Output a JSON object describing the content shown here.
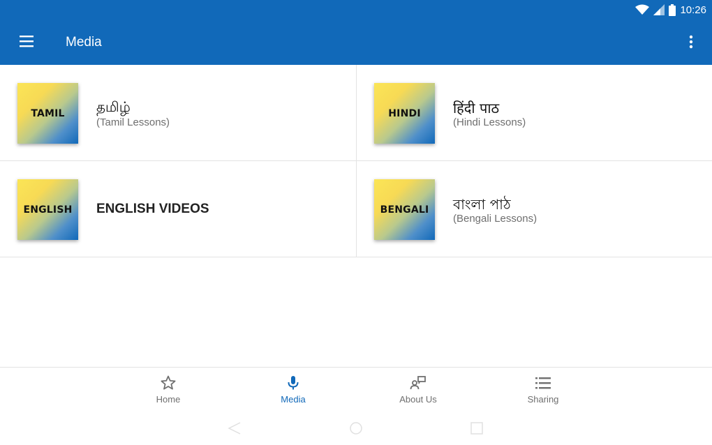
{
  "status_bar": {
    "time": "10:26"
  },
  "app_bar": {
    "title": "Media",
    "menu_icon": "hamburger-menu-icon",
    "overflow_icon": "more-vert-icon"
  },
  "media_items": [
    {
      "thumb_label": "TAMIL",
      "title": "தமிழ்",
      "subtitle": "(Tamil Lessons)"
    },
    {
      "thumb_label": "HINDI",
      "title": "हिंदी पाठ",
      "subtitle": "(Hindi Lessons)"
    },
    {
      "thumb_label": "ENGLISH",
      "title": "ENGLISH VIDEOS",
      "subtitle": ""
    },
    {
      "thumb_label": "BENGALI",
      "title": "বাংলা পাঠ",
      "subtitle": "(Bengali Lessons)"
    }
  ],
  "bottom_nav": [
    {
      "label": "Home",
      "icon": "star-icon",
      "active": false
    },
    {
      "label": "Media",
      "icon": "microphone-icon",
      "active": true
    },
    {
      "label": "About Us",
      "icon": "about-us-icon",
      "active": false
    },
    {
      "label": "Sharing",
      "icon": "list-icon",
      "active": false
    }
  ],
  "colors": {
    "primary": "#1169b9",
    "nav_inactive": "#6f6f6f",
    "divider": "#e3e3e3"
  }
}
